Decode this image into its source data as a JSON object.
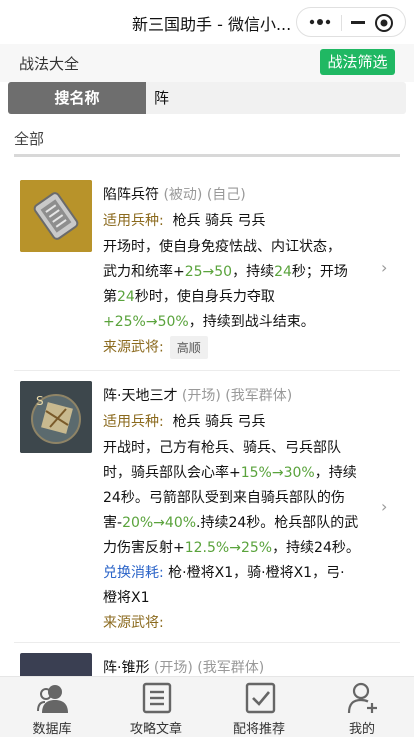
{
  "titlebar": {
    "title": "新三国助手 - 微信小..."
  },
  "header": {
    "label": "战法大全",
    "filter_button": "战法筛选"
  },
  "search": {
    "type": "搜名称",
    "value": "阵"
  },
  "tabs": {
    "all": "全部"
  },
  "labels": {
    "troop": "适用兵种:",
    "source": "来源武将:",
    "cost": "兑换消耗:"
  },
  "cards": [
    {
      "name": "陷阵兵符",
      "tag1": "(被动)",
      "tag2": "(自己)",
      "troops": "枪兵  骑兵  弓兵",
      "desc": [
        [
          {
            "t": "开场时，使自身免疫怯战、内讧状态，",
            "g": false
          }
        ],
        [
          {
            "t": "武力和统率+",
            "g": false
          },
          {
            "t": "25→50",
            "g": true
          },
          {
            "t": "，持续",
            "g": false
          },
          {
            "t": "24",
            "g": true
          },
          {
            "t": "秒；开场",
            "g": false
          }
        ],
        [
          {
            "t": "第",
            "g": false
          },
          {
            "t": "24",
            "g": true
          },
          {
            "t": "秒时，使自身兵力夺取",
            "g": false
          }
        ],
        [
          {
            "t": "+25%→50%",
            "g": true
          },
          {
            "t": "，持续到战斗结束。",
            "g": false
          }
        ]
      ],
      "generals": [
        "高顺"
      ]
    },
    {
      "name": "阵·天地三才",
      "tag1": "(开场)",
      "tag2": "(我军群体)",
      "troops": "枪兵  骑兵  弓兵",
      "desc": [
        [
          {
            "t": "开战时，己方有枪兵、骑兵、弓兵部队",
            "g": false
          }
        ],
        [
          {
            "t": "时，骑兵部队会心率+",
            "g": false
          },
          {
            "t": "15%→30%",
            "g": true
          },
          {
            "t": "，持续",
            "g": false
          }
        ],
        [
          {
            "t": "24秒。弓箭部队受到来自骑兵部队的伤",
            "g": false
          }
        ],
        [
          {
            "t": "害-",
            "g": false
          },
          {
            "t": "20%→40%",
            "g": true
          },
          {
            "t": ".持续24秒。枪兵部队的武",
            "g": false
          }
        ],
        [
          {
            "t": "力伤害反射+",
            "g": false
          },
          {
            "t": "12.5%→25%",
            "g": true
          },
          {
            "t": "，持续24秒。",
            "g": false
          }
        ]
      ],
      "cost_line1": "枪·橙将X1，骑·橙将X1，弓·",
      "cost_line2": "橙将X1"
    },
    {
      "name": "阵·锥形",
      "tag1": "(开场)",
      "tag2": "(我军群体)"
    }
  ],
  "tabbar": [
    {
      "label": "数据库",
      "icon": "user-group-icon"
    },
    {
      "label": "攻略文章",
      "icon": "article-icon"
    },
    {
      "label": "配将推荐",
      "icon": "checkbox-icon"
    },
    {
      "label": "我的",
      "icon": "add-user-icon"
    }
  ],
  "colors": {
    "accent_green": "#20b863",
    "value_green": "#5aa33c",
    "label_brown": "#8b6a1e",
    "label_blue": "#2b64c8"
  }
}
